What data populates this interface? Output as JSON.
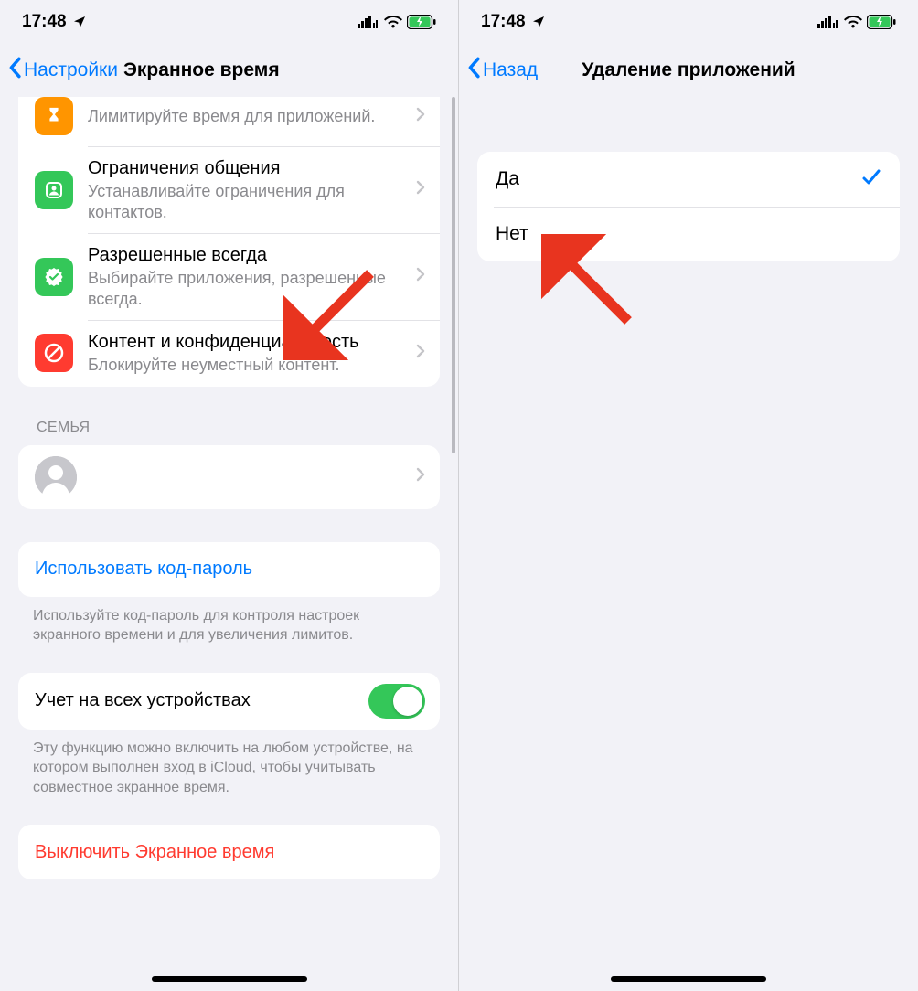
{
  "status": {
    "time": "17:48",
    "location_icon": "location-arrow",
    "signal_icon": "dual-signal",
    "wifi_icon": "wifi",
    "battery_icon": "battery-charging"
  },
  "left": {
    "nav": {
      "back": "Настройки",
      "title": "Экранное время"
    },
    "rows": [
      {
        "icon": "hourglass-icon",
        "icon_color": "orange",
        "title": "",
        "sub": "Лимитируйте время для приложений.",
        "cut": true
      },
      {
        "icon": "contact-icon",
        "icon_color": "green",
        "title": "Ограничения общения",
        "sub": "Устанавливайте ограничения для контактов."
      },
      {
        "icon": "check-badge-icon",
        "icon_color": "green",
        "title": "Разрешенные всегда",
        "sub": "Выбирайте приложения, разрешенные всегда."
      },
      {
        "icon": "nosign-icon",
        "icon_color": "red",
        "title": "Контент и конфиденциальность",
        "sub": "Блокируйте неуместный контент."
      }
    ],
    "family_header": "СЕМЬЯ",
    "family_row": {
      "avatar": "avatar-placeholder"
    },
    "passcode_row": "Использовать код-пароль",
    "passcode_footer": "Используйте код-пароль для контроля настроек экранного времени и для увеличения лимитов.",
    "share_row": "Учет на всех устройствах",
    "share_toggle": true,
    "share_footer": "Эту функцию можно включить на любом устройстве, на котором выполнен вход в iCloud, чтобы учитывать совместное экранное время.",
    "turnoff_row": "Выключить Экранное время"
  },
  "right": {
    "nav": {
      "back": "Назад",
      "title": "Удаление приложений"
    },
    "options": [
      {
        "label": "Да",
        "selected": true
      },
      {
        "label": "Нет",
        "selected": false
      }
    ]
  }
}
